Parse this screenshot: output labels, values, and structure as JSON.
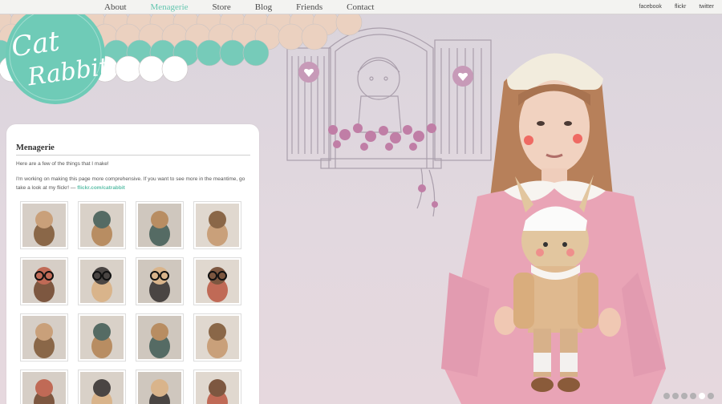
{
  "nav": {
    "items": [
      {
        "label": "About",
        "active": false
      },
      {
        "label": "Menagerie",
        "active": true
      },
      {
        "label": "Store",
        "active": false
      },
      {
        "label": "Blog",
        "active": false
      },
      {
        "label": "Friends",
        "active": false
      },
      {
        "label": "Contact",
        "active": false
      }
    ]
  },
  "social": {
    "facebook": "facebook",
    "flickr": "flickr",
    "twitter": "twitter"
  },
  "logo": {
    "line1": "Cat",
    "line2": "Rabbit"
  },
  "page": {
    "title": "Menagerie",
    "intro": "Here are a few of the things that I make!",
    "detail": "I'm working on making this page more comprehensive. If you want to see more in the meantime, go take a look at my flickr! —",
    "flickr_link": "flickr.com/catrabbit"
  },
  "gallery": {
    "thumbs": [
      "native-chief-doll",
      "brown-rabbit-doll",
      "long-hair-doll",
      "lion-doll-on-table",
      "glasses-doll-hat",
      "two-glasses-dolls",
      "glasses-doll-blue-shirt",
      "glasses-doll-tall",
      "dolls-pink-car",
      "bear-hood-doll",
      "doll-red-mask",
      "owl-doll",
      "dark-hair-doll",
      "crowned-doll",
      "penguin-doll",
      "glasses-doll-hat-2"
    ]
  },
  "slideshow": {
    "count": 6,
    "active_index": 4
  },
  "colors": {
    "accent": "#6fcbb7",
    "link": "#5cbfa8",
    "window_line": "#aa9fac",
    "heart": "#c79ab8",
    "flower": "#c07ea6"
  }
}
